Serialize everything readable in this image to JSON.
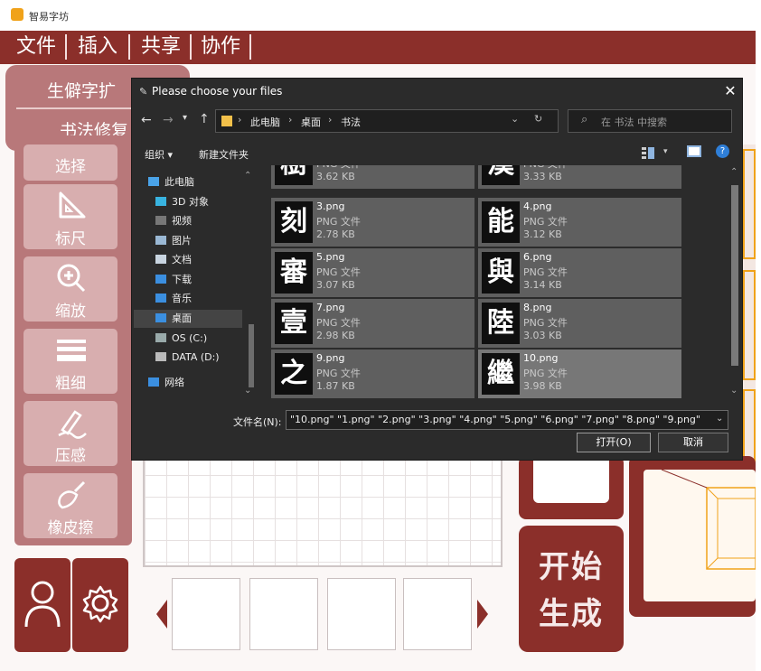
{
  "app": {
    "title": "智易字坊"
  },
  "menu": {
    "items": [
      "文件",
      "插入",
      "共享",
      "协作"
    ]
  },
  "dropdown": {
    "item1": "生僻字扩",
    "item2": "书法修复"
  },
  "tools": {
    "select": "选择",
    "ruler": "标尺",
    "zoom": "缩放",
    "thickness": "粗细",
    "pressure": "压感",
    "eraser": "橡皮擦"
  },
  "generate": {
    "line1": "开始",
    "line2": "生成"
  },
  "dialog": {
    "title": "Please choose your files",
    "breadcrumb": [
      "此电脑",
      "桌面",
      "书法"
    ],
    "search_placeholder": "在 书法 中搜索",
    "toolbar": {
      "organize": "组织 ▾",
      "new_folder": "新建文件夹"
    },
    "nav": [
      {
        "label": "此电脑",
        "icon": "pc-icon"
      },
      {
        "label": "3D 对象",
        "icon": "3d-icon"
      },
      {
        "label": "视频",
        "icon": "video-icon"
      },
      {
        "label": "图片",
        "icon": "pictures-icon"
      },
      {
        "label": "文档",
        "icon": "documents-icon"
      },
      {
        "label": "下载",
        "icon": "download-icon"
      },
      {
        "label": "音乐",
        "icon": "music-icon"
      },
      {
        "label": "桌面",
        "icon": "desktop-icon"
      },
      {
        "label": "OS (C:)",
        "icon": "drive-icon"
      },
      {
        "label": "DATA (D:)",
        "icon": "drive-icon"
      },
      {
        "label": "网络",
        "icon": "network-icon"
      }
    ],
    "files": [
      {
        "name": "",
        "type": "PNG 文件",
        "size": "3.62 KB",
        "glyph": "樹"
      },
      {
        "name": "",
        "type": "PNG 文件",
        "size": "3.33 KB",
        "glyph": "漢"
      },
      {
        "name": "3.png",
        "type": "PNG 文件",
        "size": "2.78 KB",
        "glyph": "刻"
      },
      {
        "name": "4.png",
        "type": "PNG 文件",
        "size": "3.12 KB",
        "glyph": "能"
      },
      {
        "name": "5.png",
        "type": "PNG 文件",
        "size": "3.07 KB",
        "glyph": "審"
      },
      {
        "name": "6.png",
        "type": "PNG 文件",
        "size": "3.14 KB",
        "glyph": "與"
      },
      {
        "name": "7.png",
        "type": "PNG 文件",
        "size": "2.98 KB",
        "glyph": "壹"
      },
      {
        "name": "8.png",
        "type": "PNG 文件",
        "size": "3.03 KB",
        "glyph": "陸"
      },
      {
        "name": "9.png",
        "type": "PNG 文件",
        "size": "1.87 KB",
        "glyph": "之"
      },
      {
        "name": "10.png",
        "type": "PNG 文件",
        "size": "3.98 KB",
        "glyph": "繼"
      }
    ],
    "filename_label": "文件名(N):",
    "filename_value": "\"10.png\" \"1.png\" \"2.png\" \"3.png\" \"4.png\" \"5.png\" \"6.png\" \"7.png\" \"8.png\" \"9.png\"",
    "open_label": "打开(O)",
    "cancel_label": "取消"
  },
  "colors": {
    "brand": "#8b2f2a",
    "tool_bg": "#d8aeaf",
    "dialog_bg": "#2b2b2b"
  }
}
